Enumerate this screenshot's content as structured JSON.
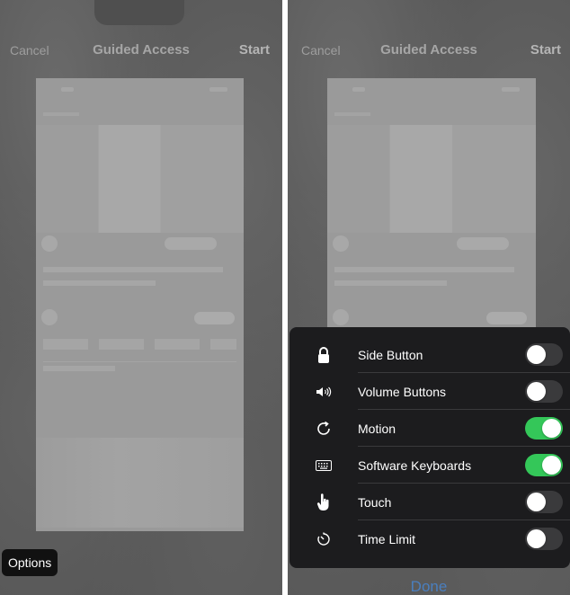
{
  "left": {
    "nav": {
      "cancel": "Cancel",
      "title": "Guided Access",
      "start": "Start"
    },
    "options_button": "Options"
  },
  "right": {
    "nav": {
      "cancel": "Cancel",
      "title": "Guided Access",
      "start": "Start"
    },
    "options": [
      {
        "label": "Side Button",
        "icon": "lock-icon",
        "enabled": false
      },
      {
        "label": "Volume Buttons",
        "icon": "speaker-icon",
        "enabled": false
      },
      {
        "label": "Motion",
        "icon": "rotate-icon",
        "enabled": true
      },
      {
        "label": "Software Keyboards",
        "icon": "keyboard-icon",
        "enabled": true
      },
      {
        "label": "Touch",
        "icon": "hand-pointer-icon",
        "enabled": false
      },
      {
        "label": "Time Limit",
        "icon": "timer-icon",
        "enabled": false
      }
    ],
    "done": "Done"
  },
  "colors": {
    "toggle_on": "#34c759",
    "toggle_off": "#3a3a3c",
    "panel": "#1c1c1e",
    "done": "#4a7fbf"
  }
}
